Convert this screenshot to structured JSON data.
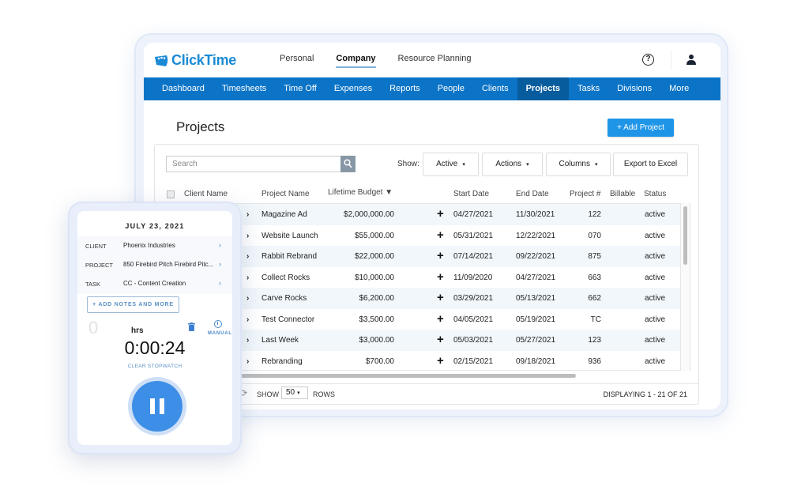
{
  "app": {
    "brand": "ClickTime",
    "top_nav": [
      {
        "label": "Personal",
        "active": false
      },
      {
        "label": "Company",
        "active": true
      },
      {
        "label": "Resource Planning",
        "active": false
      }
    ],
    "icons": {
      "help": "?",
      "user": "user-icon"
    },
    "main_nav": [
      {
        "label": "Dashboard",
        "active": false
      },
      {
        "label": "Timesheets",
        "active": false
      },
      {
        "label": "Time Off",
        "active": false
      },
      {
        "label": "Expenses",
        "active": false
      },
      {
        "label": "Reports",
        "active": false
      },
      {
        "label": "People",
        "active": false
      },
      {
        "label": "Clients",
        "active": false
      },
      {
        "label": "Projects",
        "active": true
      },
      {
        "label": "Tasks",
        "active": false
      },
      {
        "label": "Divisions",
        "active": false
      },
      {
        "label": "More",
        "active": false
      }
    ],
    "colors": {
      "brand": "#1a8ad6",
      "nav_bg": "#0b74c7",
      "nav_active": "#075c9e",
      "button": "#1f95e8"
    }
  },
  "page": {
    "title": "Projects",
    "add_button": "+ Add Project",
    "search_placeholder": "Search",
    "show_label": "Show:",
    "filters": {
      "active": "Active",
      "actions": "Actions",
      "columns": "Columns",
      "export": "Export to Excel"
    },
    "caret": "▾"
  },
  "table": {
    "headers": {
      "client": "Client Name",
      "project": "Project Name",
      "budget": "Lifetime Budget ▼",
      "start": "Start Date",
      "end": "End Date",
      "number": "Project #",
      "billable": "Billable",
      "status": "Status"
    },
    "rows": [
      {
        "project": "Magazine Ad",
        "budget": "$2,000,000.00",
        "start": "04/27/2021",
        "end": "11/30/2021",
        "number": "122",
        "billable": true,
        "status": "active"
      },
      {
        "project": "Website Launch",
        "budget": "$55,000.00",
        "start": "05/31/2021",
        "end": "12/22/2021",
        "number": "070",
        "billable": true,
        "status": "active"
      },
      {
        "project": "Rabbit Rebrand",
        "budget": "$22,000.00",
        "start": "07/14/2021",
        "end": "09/22/2021",
        "number": "875",
        "billable": true,
        "status": "active"
      },
      {
        "project": "Collect Rocks",
        "budget": "$10,000.00",
        "start": "11/09/2020",
        "end": "04/27/2021",
        "number": "663",
        "billable": true,
        "status": "active"
      },
      {
        "project": "Carve Rocks",
        "budget": "$6,200.00",
        "start": "03/29/2021",
        "end": "05/13/2021",
        "number": "662",
        "billable": true,
        "status": "active"
      },
      {
        "project": "Test Connector",
        "budget": "$3,500.00",
        "start": "04/05/2021",
        "end": "05/19/2021",
        "number": "TC",
        "billable": true,
        "status": "active"
      },
      {
        "project": "Last Week",
        "budget": "$3,000.00",
        "start": "05/03/2021",
        "end": "05/27/2021",
        "number": "123",
        "billable": true,
        "status": "active"
      },
      {
        "project": "Rebranding",
        "budget": "$700.00",
        "start": "02/15/2021",
        "end": "09/18/2021",
        "number": "936",
        "billable": true,
        "status": "active"
      }
    ],
    "footer": {
      "show": "SHOW",
      "rows_value": "50",
      "rows": "ROWS",
      "displaying": "DISPLAYING 1 - 21 OF 21"
    }
  },
  "mobile": {
    "date": "JULY 23, 2021",
    "fields": [
      {
        "label": "CLIENT",
        "value": "Phoenix Industries"
      },
      {
        "label": "PROJECT",
        "value": "850 Firebird Pitch Firebird Pitc..."
      },
      {
        "label": "TASK",
        "value": "CC - Content Creation"
      }
    ],
    "add_notes": "+ ADD NOTES AND MORE",
    "zero": "0",
    "hrs": "hrs",
    "manual": "MANUAL",
    "timer": "0:00:24",
    "clear": "CLEAR STOPWATCH"
  }
}
